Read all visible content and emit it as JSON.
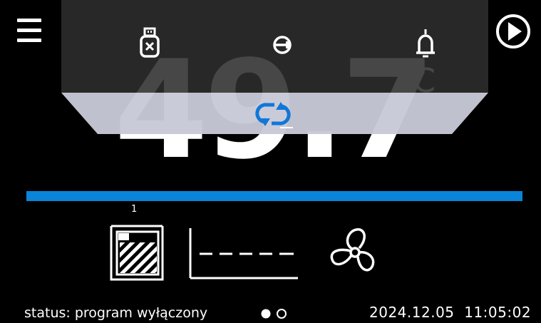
{
  "temperature": {
    "value": "49.7",
    "unit": "°C"
  },
  "top_panel": {
    "icons": [
      "usb-drive-removed-icon",
      "key-login-icon",
      "bell-alarm-icon"
    ],
    "center_icon": "sync-refresh-icon"
  },
  "header": {
    "menu_icon": "hamburger-menu-icon",
    "play_icon": "play-circle-icon"
  },
  "progress": {
    "color": "#0a84d8",
    "fraction": 1.0
  },
  "bottom_icons": {
    "chamber_number": "1",
    "icons": [
      "chamber-door-icon",
      "temperature-profile-graph-icon",
      "fan-icon"
    ]
  },
  "status_bar": {
    "status": "status: program wyłączony",
    "datetime": "2024.12.05  11:05:02",
    "pages_total": 2,
    "page_active": 1
  },
  "colors": {
    "background": "#000000",
    "panel": "#2e2e2e",
    "trapezoid": "#c8c9d6",
    "sync_icon": "#1177d9",
    "accent_bar": "#0a84d8"
  }
}
